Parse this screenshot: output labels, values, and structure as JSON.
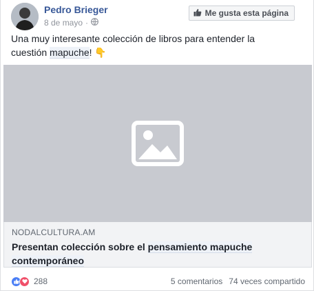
{
  "post": {
    "author": "Pedro Brieger",
    "date": "8 de mayo",
    "date_separator": "·",
    "like_page_label": "Me gusta esta página",
    "text_part1": "Una muy interesante colección de libros para entender la cuestión ",
    "text_highlight": "mapuche",
    "text_part2": "!",
    "text_emoji": "👇",
    "link": {
      "domain": "NODALCULTURA.AM",
      "title_part1": "Presentan colección sobre el ",
      "title_highlight": "pensamiento mapuche contemporáneo"
    },
    "reactions_count": "288",
    "comments": "5 comentarios",
    "shares": "74 veces compartido"
  },
  "icons": {
    "privacy": "globe-icon",
    "like_page": "thumbs-up-icon",
    "image_placeholder": "image-placeholder-icon",
    "reaction_like": "like-reaction-icon",
    "reaction_love": "love-reaction-icon"
  },
  "colors": {
    "author": "#385898",
    "image_bg": "#c8cad0",
    "like_blue": "#4a7ef5",
    "love_red": "#f0506a"
  }
}
